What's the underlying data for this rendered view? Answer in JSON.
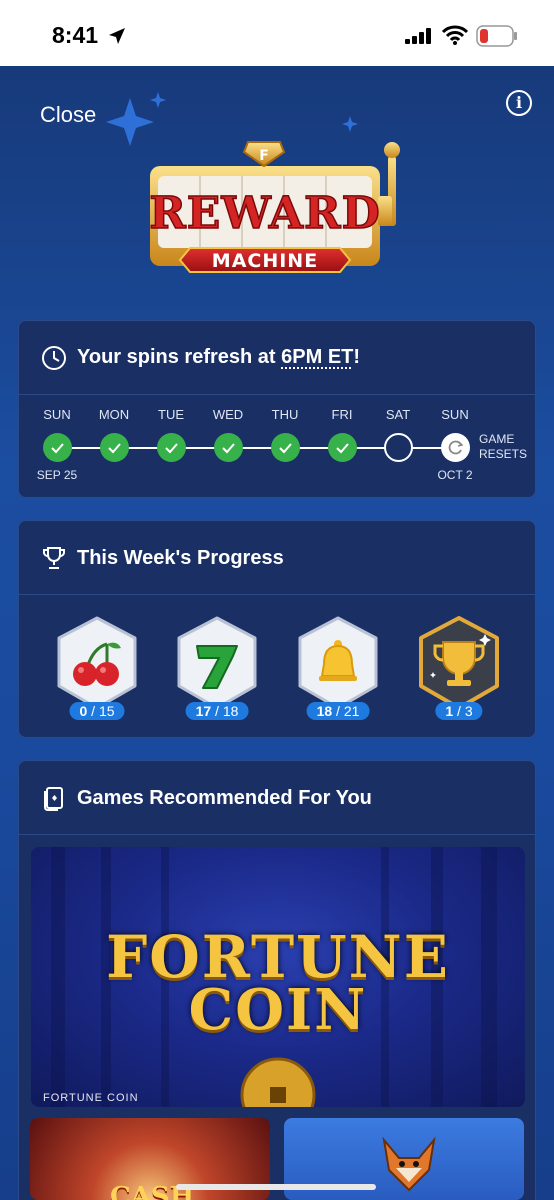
{
  "status": {
    "time": "8:41"
  },
  "header": {
    "close_label": "Close",
    "info_label": "i"
  },
  "logo": {
    "reward_text": "REWARD",
    "machine_text": "MACHINE",
    "brand_mark": "F"
  },
  "spins": {
    "prefix": "Your spins refresh at ",
    "highlight": "6PM ET",
    "suffix": "!",
    "days": [
      {
        "label": "SUN",
        "state": "done",
        "date": "SEP 25"
      },
      {
        "label": "MON",
        "state": "done",
        "date": ""
      },
      {
        "label": "TUE",
        "state": "done",
        "date": ""
      },
      {
        "label": "WED",
        "state": "done",
        "date": ""
      },
      {
        "label": "THU",
        "state": "done",
        "date": ""
      },
      {
        "label": "FRI",
        "state": "done",
        "date": ""
      },
      {
        "label": "SAT",
        "state": "empty",
        "date": ""
      },
      {
        "label": "SUN",
        "state": "reset",
        "date": "OCT 2"
      }
    ],
    "game_resets": [
      "GAME",
      "RESETS"
    ]
  },
  "progress": {
    "title": "This Week's Progress",
    "badges": [
      {
        "icon": "cherry-icon",
        "current": "0",
        "total": "15"
      },
      {
        "icon": "seven-icon",
        "current": "17",
        "total": "18"
      },
      {
        "icon": "bell-icon",
        "current": "18",
        "total": "21"
      },
      {
        "icon": "trophy-icon",
        "current": "1",
        "total": "3"
      }
    ]
  },
  "games": {
    "title": "Games Recommended For You",
    "featured": {
      "title_line1": "FORTUNE",
      "title_line2": "COIN",
      "caption": "FORTUNE COIN"
    },
    "tile_left_text": "CASH"
  },
  "colors": {
    "check_green": "#37b14a",
    "badge_blue": "#1f7ae0",
    "gold": "#f5c542",
    "card_bg": "#1a2f64"
  }
}
